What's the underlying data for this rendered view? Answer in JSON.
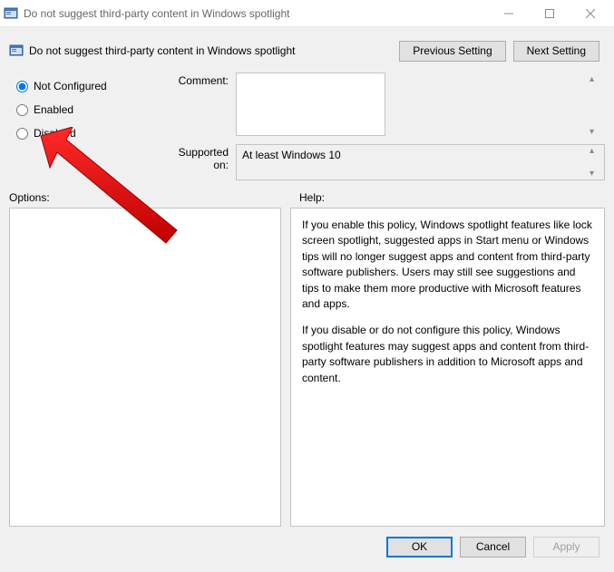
{
  "titlebar": {
    "title": "Do not suggest third-party content in Windows spotlight"
  },
  "header": {
    "title": "Do not suggest third-party content in Windows spotlight",
    "prev_label": "Previous Setting",
    "next_label": "Next Setting"
  },
  "radios": {
    "not_configured": "Not Configured",
    "enabled": "Enabled",
    "disabled": "Disabled",
    "selected": "not_configured"
  },
  "fields": {
    "comment_label": "Comment:",
    "comment_value": "",
    "supported_label": "Supported on:",
    "supported_value": "At least Windows 10"
  },
  "mid": {
    "options_label": "Options:",
    "help_label": "Help:"
  },
  "help": {
    "para1": "If you enable this policy, Windows spotlight features like lock screen spotlight, suggested apps in Start menu or Windows tips will no longer suggest apps and content from third-party software publishers. Users may still see suggestions and tips to make them more productive with Microsoft features and apps.",
    "para2": "If you disable or do not configure this policy, Windows spotlight features may suggest apps and content from third-party software publishers in addition to Microsoft apps and content."
  },
  "footer": {
    "ok": "OK",
    "cancel": "Cancel",
    "apply": "Apply"
  }
}
